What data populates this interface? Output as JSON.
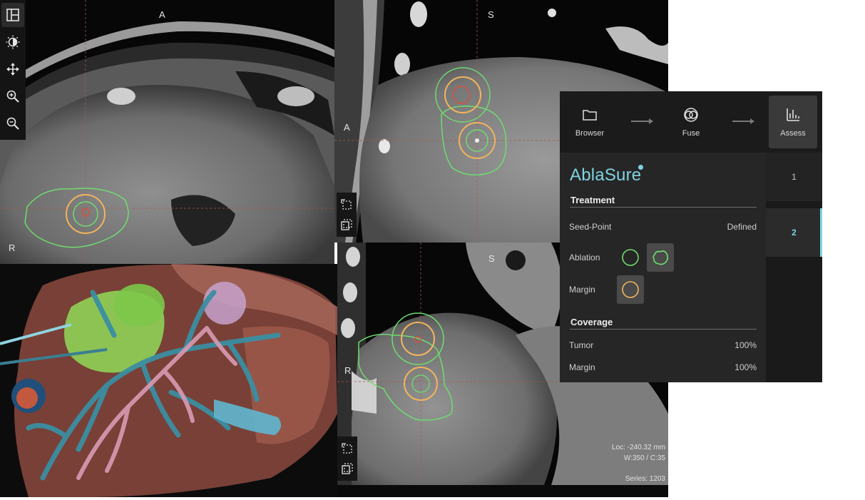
{
  "viewports": {
    "axial": {
      "orientation_top": "A",
      "orientation_left": "R"
    },
    "sagittal": {
      "orientation_top": "S",
      "orientation_left": "A"
    },
    "coronal": {
      "orientation_top": "S",
      "orientation_left": "R"
    }
  },
  "toolbar": {
    "tools": [
      {
        "icon": "layout-icon"
      },
      {
        "icon": "brightness-contrast-icon"
      },
      {
        "icon": "pan-icon"
      },
      {
        "icon": "zoom-in-icon"
      },
      {
        "icon": "zoom-out-icon"
      }
    ]
  },
  "info": {
    "loc": "Loc: -240.32 mm",
    "window": "W:350 / C:35",
    "series": "Series: 1203"
  },
  "workflow": {
    "steps": [
      {
        "label": "Browser",
        "icon": "folder-icon"
      },
      {
        "label": "Fuse",
        "icon": "fuse-icon"
      },
      {
        "label": "Assess",
        "icon": "bar-chart-icon"
      }
    ],
    "active": "Assess"
  },
  "panel": {
    "brand": "AblaSure",
    "treatment_title": "Treatment",
    "seed_point_label": "Seed-Point",
    "seed_point_value": "Defined",
    "ablation_label": "Ablation",
    "margin_label": "Margin",
    "coverage_title": "Coverage",
    "tumor_label": "Tumor",
    "tumor_value": "100%",
    "margin_cov_label": "Margin",
    "margin_cov_value": "100%"
  },
  "tabs": [
    {
      "label": "1"
    },
    {
      "label": "2"
    }
  ],
  "colors": {
    "accent": "#7fd3e0",
    "ablation_contour": "#6fdc6f",
    "margin_contour": "#f2b45c",
    "tumor_contour": "#d9503f"
  }
}
